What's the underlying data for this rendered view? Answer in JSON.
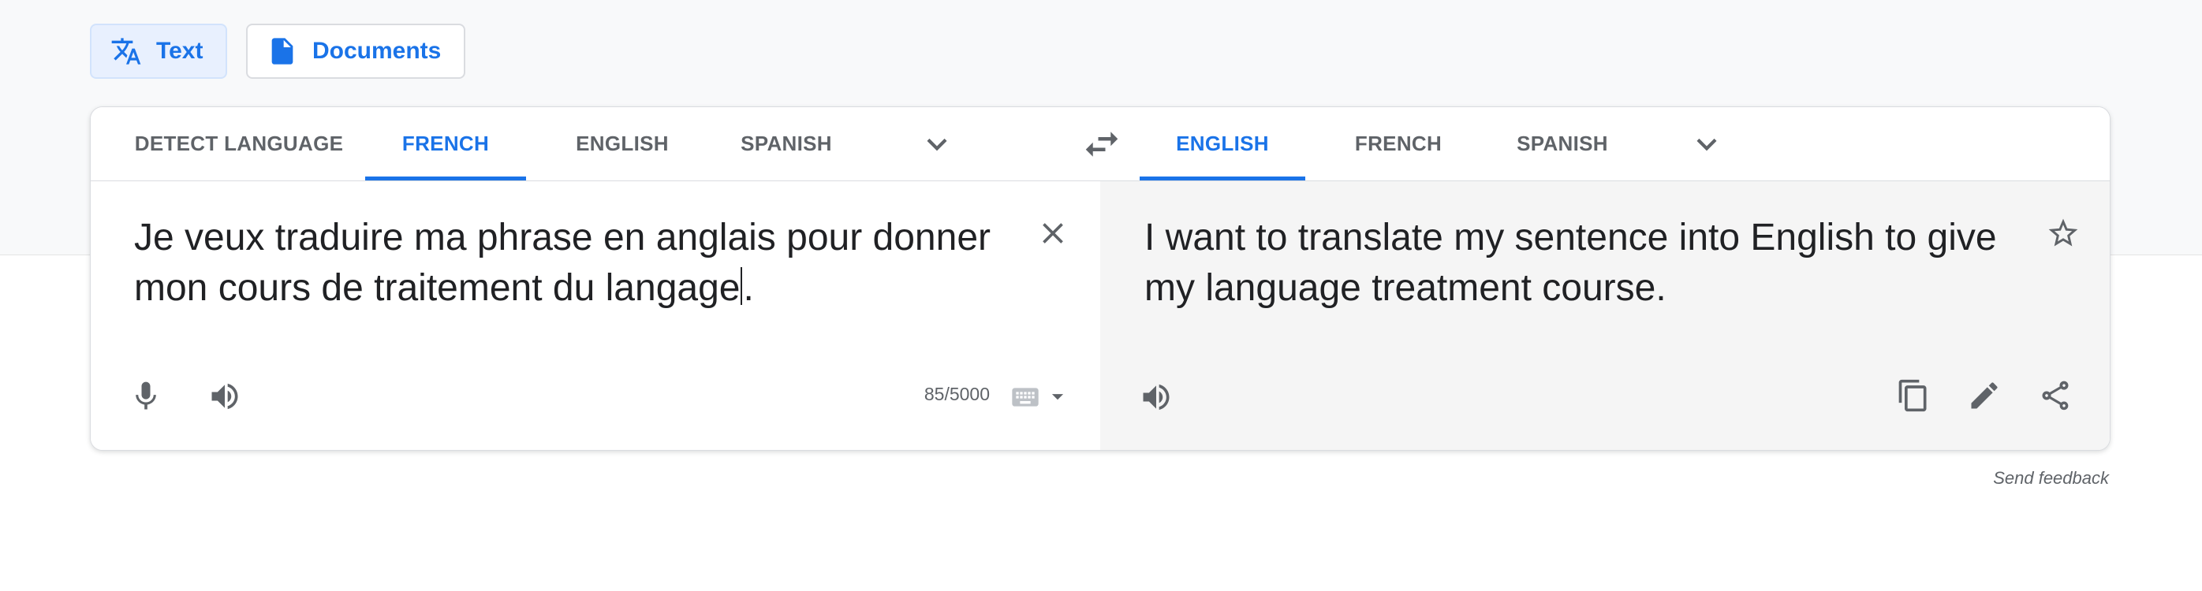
{
  "mode_tabs": {
    "text_label": "Text",
    "documents_label": "Documents"
  },
  "source_languages": {
    "tabs": [
      "DETECT LANGUAGE",
      "FRENCH",
      "ENGLISH",
      "SPANISH"
    ],
    "active": "FRENCH"
  },
  "target_languages": {
    "tabs": [
      "ENGLISH",
      "FRENCH",
      "SPANISH"
    ],
    "active": "ENGLISH"
  },
  "source": {
    "text_before_caret": "Je veux traduire ma phrase en anglais pour donner mon cours de traitement du langage",
    "text_after_caret": ".",
    "char_count": "85/5000"
  },
  "target": {
    "text": "I want to translate my sentence into English to give my language treatment course."
  },
  "feedback_label": "Send feedback",
  "colors": {
    "accent": "#1a73e8",
    "target_bg": "#f5f5f5",
    "band_bg": "#f8f9fa"
  },
  "icons": [
    "translate-icon",
    "document-icon",
    "chevron-down-icon",
    "swap-icon",
    "close-icon",
    "mic-icon",
    "volume-icon",
    "keyboard-icon",
    "arrow-drop-down-icon",
    "star-icon",
    "copy-icon",
    "edit-icon",
    "share-icon"
  ]
}
